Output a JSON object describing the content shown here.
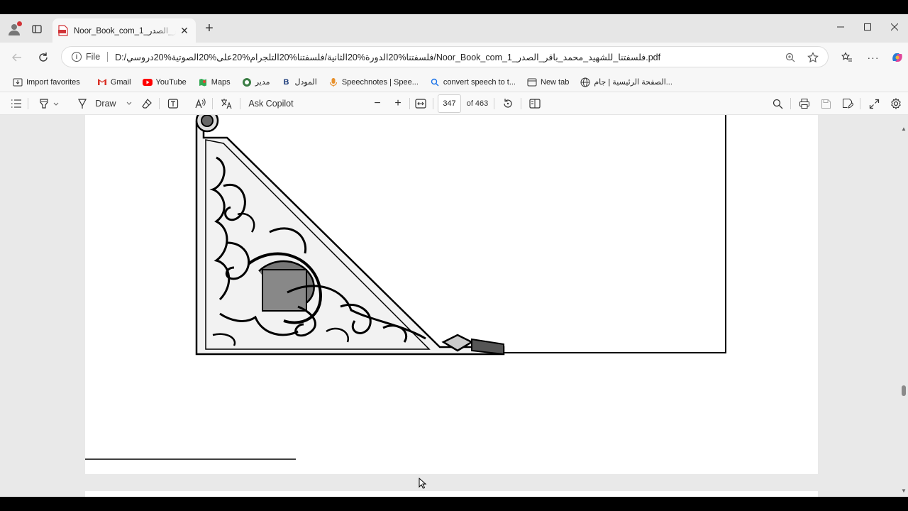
{
  "browser": {
    "tab": {
      "title": "Noor_Book_com_1_فلسفتنا_للشهيد_محمد_باقر_الصدر",
      "close_glyph": "✕"
    },
    "new_tab_glyph": "+",
    "window_controls": {
      "minimize": "—",
      "maximize": "☐",
      "close": "✕"
    }
  },
  "address": {
    "protocol_label": "File",
    "url": "D:/فلسفتنا%20الدورة%20الثانية/فلسفتنا%20التلجرام%20على%20الصوتية%20دروسي/Noor_Book_com_1_فلسفتنا_للشهيد_محمد_باقر_الصدر.pdf"
  },
  "favorites": [
    {
      "label": "Import favorites",
      "icon": "import-icon"
    },
    {
      "label": "Gmail",
      "icon": "gmail-icon",
      "color": "#d93025"
    },
    {
      "label": "YouTube",
      "icon": "youtube-icon",
      "color": "#ff0000"
    },
    {
      "label": "Maps",
      "icon": "maps-icon"
    },
    {
      "label": "مدير",
      "icon": "manager-icon"
    },
    {
      "label": "المودل",
      "icon": "moodle-icon",
      "glyph": "B"
    },
    {
      "label": "Speechnotes | Spee...",
      "icon": "speechnotes-icon"
    },
    {
      "label": "convert speech to t...",
      "icon": "search-icon"
    },
    {
      "label": "New tab",
      "icon": "newtab-icon"
    },
    {
      "label": "الصفحة الرئيسية | جام...",
      "icon": "globe-icon"
    }
  ],
  "pdf_toolbar": {
    "draw_label": "Draw",
    "copilot_label": "Ask Copilot",
    "zoom_out": "−",
    "zoom_in": "+",
    "page_number": "347",
    "page_total": "of 463"
  },
  "colors": {
    "tab_strip": "#e6e6e6",
    "toolbar": "#f7f7f7",
    "viewer_bg": "#e9e9e9",
    "pdf_red": "#d13438"
  }
}
